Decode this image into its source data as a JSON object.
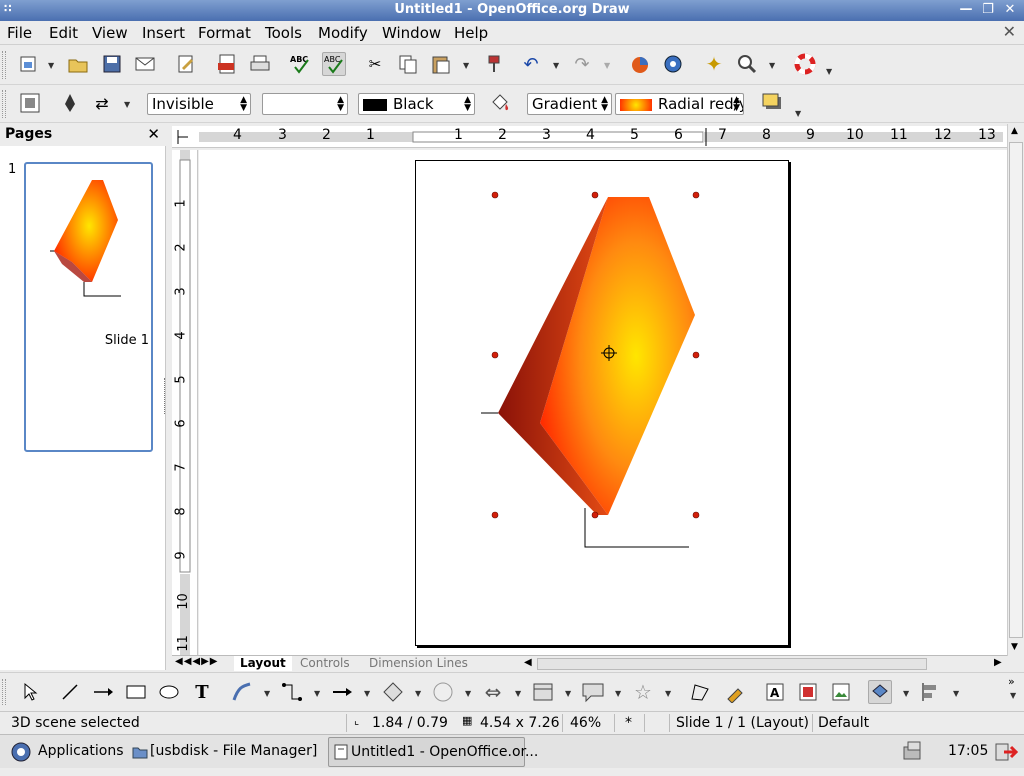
{
  "window": {
    "title": "Untitled1 - OpenOffice.org Draw"
  },
  "menu": [
    "File",
    "Edit",
    "View",
    "Insert",
    "Format",
    "Tools",
    "Modify",
    "Window",
    "Help"
  ],
  "line_toolbar": {
    "line_style": "Invisible",
    "line_width": "",
    "line_color": "Black",
    "fill_type": "Gradient",
    "fill_value": "Radial red/yellow",
    "colors": {
      "line_color": "#000000",
      "gradient_start": "#ff2a00",
      "gradient_end": "#ffe600",
      "shadow": "#f4d360"
    }
  },
  "pages_panel": {
    "title": "Pages",
    "slides": [
      {
        "number": "1",
        "label": "Slide 1"
      }
    ]
  },
  "rulers": {
    "horizontal": [
      "4",
      "3",
      "2",
      "1",
      "1",
      "2",
      "3",
      "4",
      "5",
      "6",
      "7",
      "8",
      "9",
      "10",
      "11",
      "12",
      "13"
    ],
    "vertical": [
      "1",
      "2",
      "3",
      "4",
      "5",
      "6",
      "7",
      "8",
      "9",
      "10",
      "11"
    ]
  },
  "layer_tabs": [
    "Layout",
    "Controls",
    "Dimension Lines"
  ],
  "status": {
    "message": "3D scene selected",
    "position": "1.84 / 0.79",
    "size": "4.54 x 7.26",
    "zoom": "46%",
    "modified": "*",
    "slide": "Slide 1 / 1 (Layout)",
    "layout": "Default"
  },
  "taskbar": {
    "menu_label": "Applications",
    "tasks": [
      {
        "label": "[usbdisk - File Manager]",
        "active": false
      },
      {
        "label": "Untitled1 - OpenOffice.or...",
        "active": true
      }
    ],
    "clock": "17:05"
  }
}
